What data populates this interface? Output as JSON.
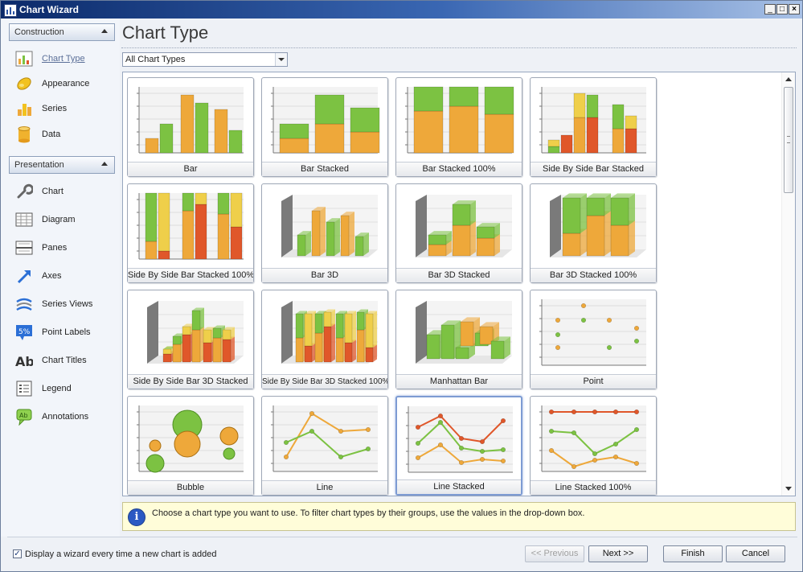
{
  "window": {
    "title": "Chart Wizard",
    "minimize": "_",
    "maximize": "□",
    "close": "×"
  },
  "sidebar": {
    "construction": {
      "header": "Construction",
      "items": [
        {
          "label": "Chart Type",
          "icon": "chart-type-icon"
        },
        {
          "label": "Appearance",
          "icon": "appearance-icon"
        },
        {
          "label": "Series",
          "icon": "series-icon"
        },
        {
          "label": "Data",
          "icon": "data-icon"
        }
      ]
    },
    "presentation": {
      "header": "Presentation",
      "items": [
        {
          "label": "Chart",
          "icon": "wrench-icon"
        },
        {
          "label": "Diagram",
          "icon": "diagram-icon"
        },
        {
          "label": "Panes",
          "icon": "panes-icon"
        },
        {
          "label": "Axes",
          "icon": "axes-arrow-icon"
        },
        {
          "label": "Series Views",
          "icon": "series-views-icon"
        },
        {
          "label": "Point Labels",
          "icon": "point-labels-icon"
        },
        {
          "label": "Chart Titles",
          "icon": "chart-titles-icon"
        },
        {
          "label": "Legend",
          "icon": "legend-icon"
        },
        {
          "label": "Annotations",
          "icon": "annotations-icon"
        }
      ]
    }
  },
  "main": {
    "title": "Chart Type",
    "filter": {
      "value": "All Chart Types"
    },
    "gallery": [
      {
        "caption": "Bar",
        "kind": "bar"
      },
      {
        "caption": "Bar Stacked",
        "kind": "bar-stacked"
      },
      {
        "caption": "Bar Stacked 100%",
        "kind": "bar-stacked-100"
      },
      {
        "caption": "Side By Side Bar Stacked",
        "kind": "sbs-bar-stacked"
      },
      {
        "caption": "Side By Side Bar Stacked 100%",
        "kind": "sbs-bar-stacked-100"
      },
      {
        "caption": "Bar 3D",
        "kind": "bar-3d"
      },
      {
        "caption": "Bar 3D Stacked",
        "kind": "bar-3d-stacked"
      },
      {
        "caption": "Bar 3D Stacked 100%",
        "kind": "bar-3d-stacked-100"
      },
      {
        "caption": "Side By Side Bar 3D Stacked",
        "kind": "sbs-3d"
      },
      {
        "caption": "Side By Side Bar 3D Stacked 100%",
        "kind": "sbs-3d-100"
      },
      {
        "caption": "Manhattan Bar",
        "kind": "manhattan"
      },
      {
        "caption": "Point",
        "kind": "point"
      },
      {
        "caption": "Bubble",
        "kind": "bubble"
      },
      {
        "caption": "Line",
        "kind": "line"
      },
      {
        "caption": "Line Stacked",
        "kind": "line-stacked",
        "selected": true
      },
      {
        "caption": "Line Stacked 100%",
        "kind": "line-stacked-100"
      }
    ],
    "hint": "Choose a chart type you want to use. To filter chart types by their groups, use the values in the drop-down box."
  },
  "footer": {
    "checkbox_label": "Display a wizard every time a new chart is added",
    "checkbox_mark": "✓",
    "previous": "<< Previous",
    "next": "Next >>",
    "finish": "Finish",
    "cancel": "Cancel"
  },
  "colors": {
    "green": "#7cc242",
    "orange": "#eea83a",
    "red": "#e0572a",
    "yellow": "#efcf4a",
    "gray": "#8a8a8a",
    "selected_border": "#7d9bd3"
  }
}
